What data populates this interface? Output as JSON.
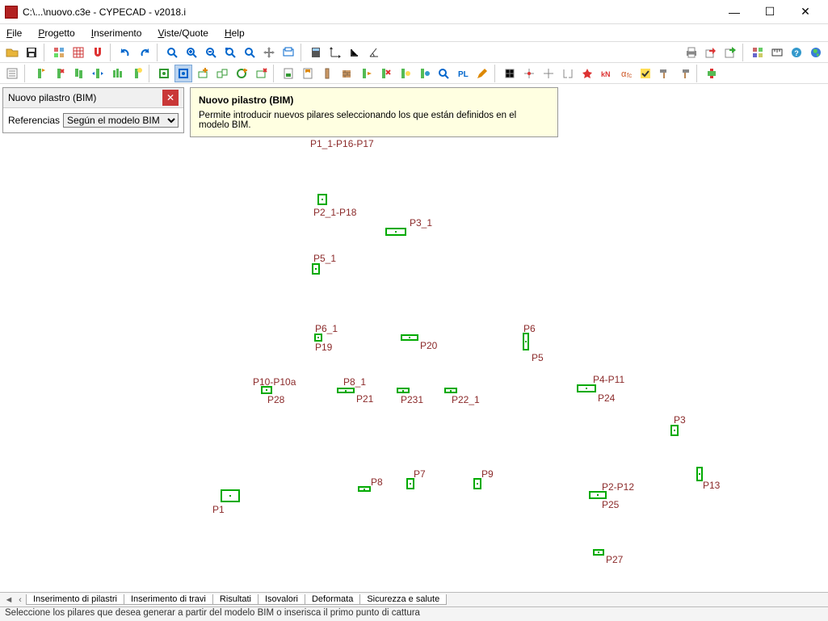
{
  "window": {
    "title": "C:\\...\\nuovo.c3e - CYPECAD - v2018.i"
  },
  "menu": {
    "file": "File",
    "progetto": "Progetto",
    "inserimento": "Inserimento",
    "viste": "Viste/Quote",
    "help": "Help"
  },
  "panel": {
    "title": "Nuovo pilastro (BIM)",
    "ref_label": "Referencias",
    "ref_value": "Según el modelo BIM"
  },
  "tooltip": {
    "title": "Nuovo pilastro (BIM)",
    "body": "Permite introducir nuevos pilares seleccionando los que están definidos en el modelo BIM."
  },
  "tabs": {
    "t1": "Inserimento di pilastri",
    "t2": "Inserimento di travi",
    "t3": "Risultati",
    "t4": "Isovalori",
    "t5": "Deformata",
    "t6": "Sicurezza e salute"
  },
  "status": {
    "text": "Seleccione los pilares que desea generar a partir del modelo BIM o inserisca il primo punto di cattura"
  },
  "pilars": {
    "p1_1": {
      "label": "P1_1-P16-P17"
    },
    "p2_1": {
      "label": "P2_1-P18"
    },
    "p3_1": {
      "label": "P3_1"
    },
    "p5_1": {
      "label": "P5_1"
    },
    "p6_1": {
      "label": "P6_1"
    },
    "p19": {
      "label": "P19"
    },
    "p20": {
      "label": "P20"
    },
    "p6": {
      "label": "P6"
    },
    "p5": {
      "label": "P5"
    },
    "p10": {
      "label": "P10-P10a"
    },
    "p28": {
      "label": "P28"
    },
    "p8_1": {
      "label": "P8_1"
    },
    "p21": {
      "label": "P21"
    },
    "p231": {
      "label": "P231"
    },
    "p22_1": {
      "label": "P22_1"
    },
    "p4": {
      "label": "P4-P11"
    },
    "p24": {
      "label": "P24"
    },
    "p3": {
      "label": "P3"
    },
    "p8": {
      "label": "P8"
    },
    "p7": {
      "label": "P7"
    },
    "p9": {
      "label": "P9"
    },
    "p2": {
      "label": "P2-P12"
    },
    "p25": {
      "label": "P25"
    },
    "p13": {
      "label": "P13"
    },
    "p1": {
      "label": "P1"
    },
    "p27": {
      "label": "P27"
    }
  }
}
